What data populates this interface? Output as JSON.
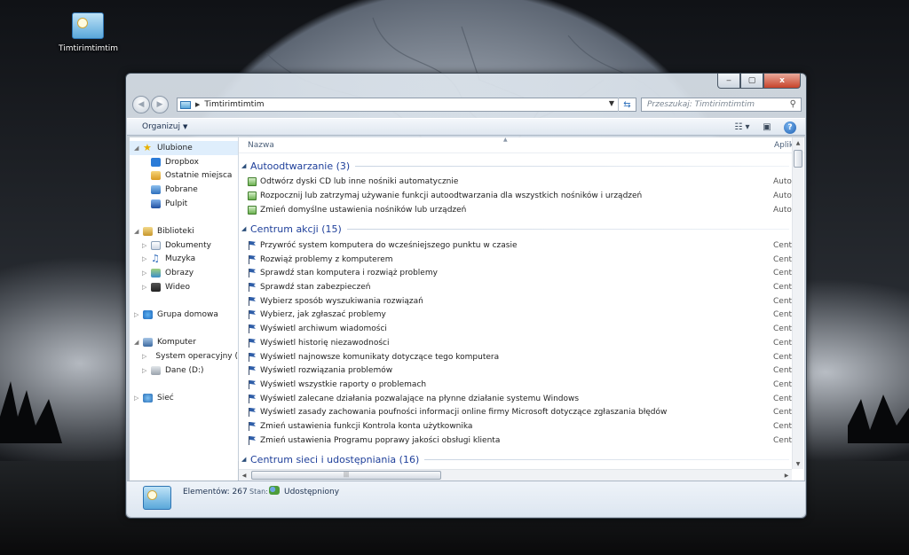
{
  "desktop": {
    "icon_label": "Timtirimtimtim"
  },
  "window": {
    "caption_buttons": {
      "minimize": "‒",
      "maximize": "▢",
      "close": "x"
    },
    "address": {
      "path": "Timtirimtimtim"
    },
    "search": {
      "placeholder": "Przeszukaj: Timtirimtimtim"
    },
    "toolbar": {
      "organize_label": "Organizuj"
    }
  },
  "navpane": {
    "favorites": {
      "label": "Ulubione",
      "items": [
        "Dropbox",
        "Ostatnie miejsca",
        "Pobrane",
        "Pulpit"
      ]
    },
    "libraries": {
      "label": "Biblioteki",
      "items": [
        "Dokumenty",
        "Muzyka",
        "Obrazy",
        "Wideo"
      ]
    },
    "homegroup": {
      "label": "Grupa domowa"
    },
    "computer": {
      "label": "Komputer",
      "items": [
        "System operacyjny (",
        "Dane (D:)"
      ]
    },
    "network": {
      "label": "Sieć"
    }
  },
  "content": {
    "columns": {
      "name": "Nazwa",
      "app": "Aplik"
    },
    "groups": [
      {
        "title": "Autoodtwarzanie (3)",
        "icon": "autoplay-icon",
        "items": [
          {
            "name": "Odtwórz dyski CD lub inne nośniki automatycznie",
            "app": "Auto"
          },
          {
            "name": "Rozpocznij lub zatrzymaj używanie funkcji autoodtwarzania dla wszystkich nośników i urządzeń",
            "app": "Auto"
          },
          {
            "name": "Zmień domyślne ustawienia nośników lub urządzeń",
            "app": "Auto"
          }
        ]
      },
      {
        "title": "Centrum akcji (15)",
        "icon": "flag-icon",
        "items": [
          {
            "name": "Przywróć system komputera do wcześniejszego punktu w czasie",
            "app": "Cent"
          },
          {
            "name": "Rozwiąż problemy z komputerem",
            "app": "Cent"
          },
          {
            "name": "Sprawdź stan komputera i rozwiąż problemy",
            "app": "Cent"
          },
          {
            "name": "Sprawdź stan zabezpieczeń",
            "app": "Cent"
          },
          {
            "name": "Wybierz sposób wyszukiwania rozwiązań",
            "app": "Cent"
          },
          {
            "name": "Wybierz, jak zgłaszać problemy",
            "app": "Cent"
          },
          {
            "name": "Wyświetl archiwum wiadomości",
            "app": "Cent"
          },
          {
            "name": "Wyświetl historię niezawodności",
            "app": "Cent"
          },
          {
            "name": "Wyświetl najnowsze komunikaty dotyczące tego komputera",
            "app": "Cent"
          },
          {
            "name": "Wyświetl rozwiązania problemów",
            "app": "Cent"
          },
          {
            "name": "Wyświetl wszystkie raporty o problemach",
            "app": "Cent"
          },
          {
            "name": "Wyświetl zalecane działania pozwalające na płynne działanie systemu Windows",
            "app": "Cent"
          },
          {
            "name": "Wyświetl zasady zachowania poufności informacji online firmy Microsoft dotyczące zgłaszania błędów",
            "app": "Cent"
          },
          {
            "name": "Zmień ustawienia funkcji Kontrola konta użytkownika",
            "app": "Cent"
          },
          {
            "name": "Zmień ustawienia Programu poprawy jakości obsługi klienta",
            "app": "Cent"
          }
        ]
      },
      {
        "title": "Centrum sieci i udostępniania (16)",
        "icon": "network-center-icon",
        "items": []
      }
    ]
  },
  "details": {
    "count": "Elementów: 267",
    "state_label": "Stan:",
    "state_value": "Udostępniony"
  }
}
